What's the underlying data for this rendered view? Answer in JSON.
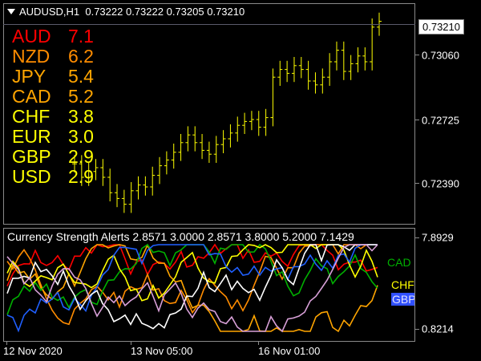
{
  "chart_header": {
    "symbol": "AUDUSD,H1",
    "open": "0.73222",
    "high": "0.73222",
    "low": "0.73205",
    "close": "0.73210"
  },
  "strength_table": [
    {
      "currency": "AUD",
      "value": "7.1",
      "color": "#ff0000"
    },
    {
      "currency": "NZD",
      "value": "6.2",
      "color": "#ff8c00"
    },
    {
      "currency": "JPY",
      "value": "5.4",
      "color": "#ffa500"
    },
    {
      "currency": "CAD",
      "value": "5.2",
      "color": "#ffa500"
    },
    {
      "currency": "CHF",
      "value": "3.8",
      "color": "#ffff00"
    },
    {
      "currency": "EUR",
      "value": "3.0",
      "color": "#ffff00"
    },
    {
      "currency": "GBP",
      "value": "2.9",
      "color": "#ffff00"
    },
    {
      "currency": "USD",
      "value": "2.9",
      "color": "#ffff00"
    }
  ],
  "price_axis": {
    "current": "0.73210",
    "labels": [
      "0.73060",
      "0.72725",
      "0.72390"
    ]
  },
  "indicator": {
    "title": "Currency Strength Alerts 2.8571 3.0000 2.8571 3.8000 5.2000 7.1429",
    "axis_max": "7.8929",
    "axis_min": "0.8214",
    "line_labels": [
      {
        "text": "CAD",
        "color": "#00b000"
      },
      {
        "text": "CHF",
        "color": "#ffff00"
      },
      {
        "text": "GBP",
        "color": "#e0e0ff"
      }
    ]
  },
  "time_axis": [
    "12 Nov 2020",
    "13 Nov 05:00",
    "16 Nov 01:00"
  ],
  "colors": {
    "background": "#000000",
    "candles": "#ffff00",
    "grid_border": "#8a8a8a"
  },
  "chart_data": {
    "type": "line",
    "title": "AUDUSD,H1",
    "ylim": [
      0.7215,
      0.733
    ],
    "series": [
      {
        "name": "AUDUSD",
        "values": [
          0.7247,
          0.724,
          0.7243,
          0.7245,
          0.724,
          0.7232,
          0.7229,
          0.7226,
          0.7233,
          0.7236,
          0.7235,
          0.7241,
          0.7246,
          0.7249,
          0.7253,
          0.7258,
          0.7262,
          0.7258,
          0.7254,
          0.7252,
          0.7257,
          0.726,
          0.7263,
          0.7267,
          0.7269,
          0.727,
          0.7266,
          0.7271,
          0.7292,
          0.7296,
          0.7294,
          0.7298,
          0.7296,
          0.729,
          0.7288,
          0.7292,
          0.73,
          0.7306,
          0.7295,
          0.7299,
          0.7303,
          0.73,
          0.7318,
          0.7321
        ]
      }
    ]
  }
}
